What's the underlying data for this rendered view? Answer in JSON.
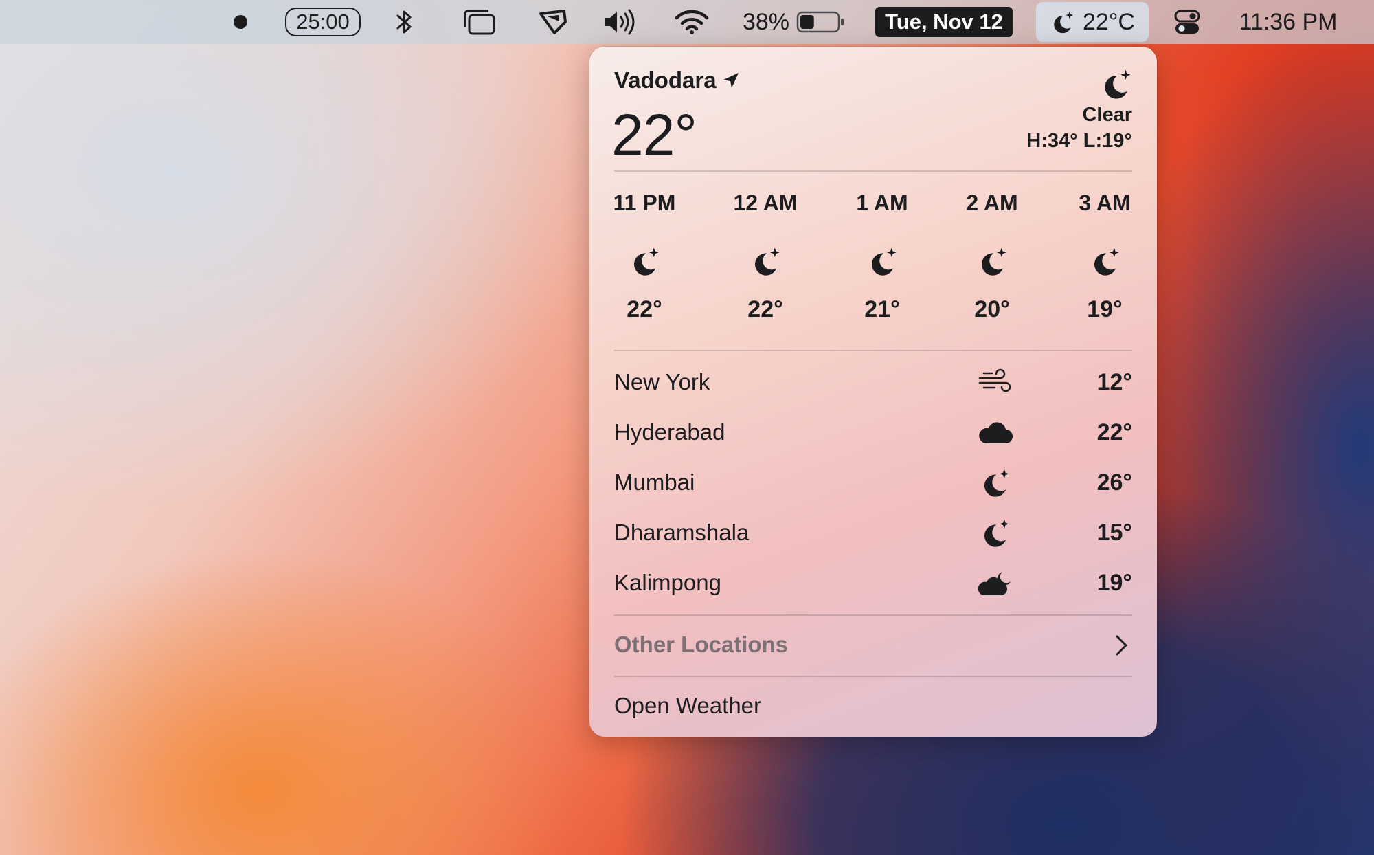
{
  "menubar": {
    "timer": "25:00",
    "battery_percent": "38%",
    "battery_level": 0.38,
    "date": "Tue, Nov 12",
    "weather_temp": "22°C",
    "clock": "11:36 PM",
    "icons": [
      "record-dot-icon",
      "bluetooth-icon",
      "window-switcher-icon",
      "shield-app-icon",
      "volume-icon",
      "wifi-icon",
      "battery-icon",
      "moon-star-icon",
      "control-center-icon"
    ]
  },
  "weather": {
    "location": "Vadodara",
    "current_temp": "22°",
    "condition": "Clear",
    "high_low": "H:34° L:19°",
    "hourly": [
      {
        "time": "11 PM",
        "temp": "22°",
        "icon": "moon-star-icon"
      },
      {
        "time": "12 AM",
        "temp": "22°",
        "icon": "moon-star-icon"
      },
      {
        "time": "1 AM",
        "temp": "21°",
        "icon": "moon-star-icon"
      },
      {
        "time": "2 AM",
        "temp": "20°",
        "icon": "moon-star-icon"
      },
      {
        "time": "3 AM",
        "temp": "19°",
        "icon": "moon-star-icon"
      }
    ],
    "cities": [
      {
        "name": "New York",
        "temp": "12°",
        "icon": "wind-icon"
      },
      {
        "name": "Hyderabad",
        "temp": "22°",
        "icon": "cloud-icon"
      },
      {
        "name": "Mumbai",
        "temp": "26°",
        "icon": "moon-star-icon"
      },
      {
        "name": "Dharamshala",
        "temp": "15°",
        "icon": "moon-star-icon"
      },
      {
        "name": "Kalimpong",
        "temp": "19°",
        "icon": "cloud-moon-icon"
      }
    ],
    "other_locations": "Other Locations",
    "open_weather": "Open Weather"
  }
}
